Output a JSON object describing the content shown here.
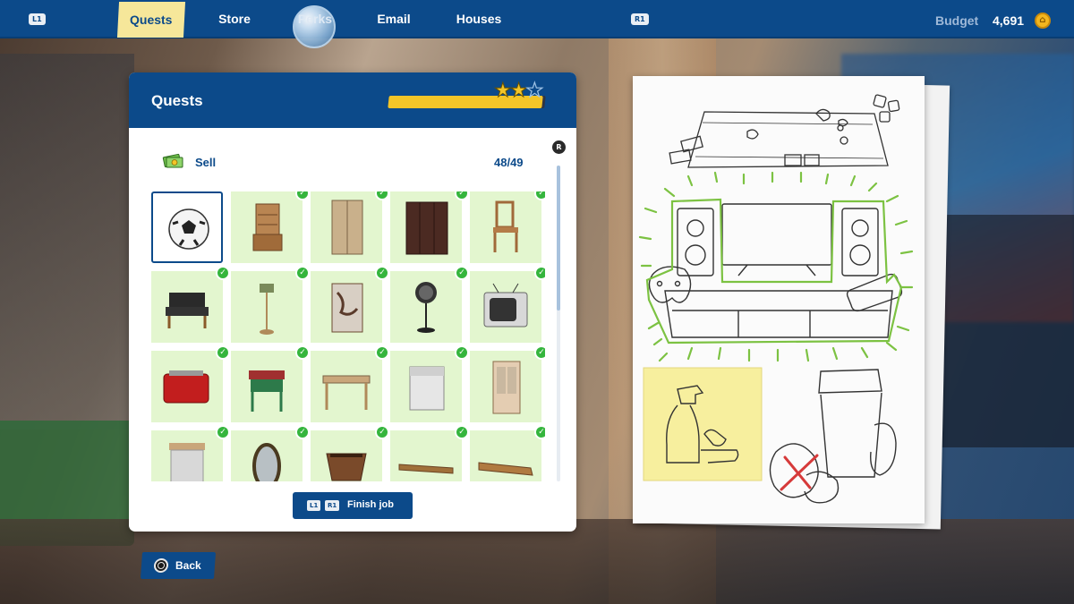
{
  "topbar": {
    "left_hint": "L1",
    "right_hint": "R1",
    "tabs": [
      {
        "label": "Quests",
        "active": true
      },
      {
        "label": "Store",
        "active": false
      },
      {
        "label": "Perks",
        "active": false
      },
      {
        "label": "Email",
        "active": false
      },
      {
        "label": "Houses",
        "active": false
      }
    ],
    "budget_label": "Budget",
    "budget_value": "4,691",
    "coin_icon": "coin-icon"
  },
  "quests_panel": {
    "title": "Quests",
    "progress_fraction": 0.98,
    "stars_earned": 2,
    "stars_total": 3,
    "scroll_hint": "R",
    "section": {
      "label": "Sell",
      "count": "48/49",
      "icon": "money-icon"
    },
    "items": [
      {
        "name": "soccer-ball",
        "done": false,
        "selected": true
      },
      {
        "name": "wooden-cabinet-shelf",
        "done": true
      },
      {
        "name": "wooden-wardrobe",
        "done": true
      },
      {
        "name": "dark-wardrobe",
        "done": true
      },
      {
        "name": "wooden-chair",
        "done": true
      },
      {
        "name": "black-armchair",
        "done": true
      },
      {
        "name": "floor-lamp",
        "done": true
      },
      {
        "name": "folding-screen",
        "done": true
      },
      {
        "name": "standing-fan",
        "done": true
      },
      {
        "name": "retro-tv",
        "done": true
      },
      {
        "name": "red-toaster",
        "done": true
      },
      {
        "name": "green-side-table",
        "done": true
      },
      {
        "name": "wooden-table",
        "done": true
      },
      {
        "name": "washing-machine",
        "done": true
      },
      {
        "name": "glass-cabinet",
        "done": true
      },
      {
        "name": "kitchen-cabinet",
        "done": true
      },
      {
        "name": "oval-mirror",
        "done": true
      },
      {
        "name": "plant-pot",
        "done": true
      },
      {
        "name": "wooden-plank",
        "done": true
      },
      {
        "name": "broken-plank",
        "done": true
      }
    ],
    "finish_button": {
      "hint_left": "L1",
      "hint_right": "R1",
      "label": "Finish job"
    },
    "scroll_fraction": 0.46
  },
  "back_button": {
    "label": "Back",
    "icon": "circle-button-icon"
  },
  "notepad": {
    "sketches": [
      "board-game-sketch",
      "tv-console-sketch",
      "cleaning-supplies-note",
      "trash-bin-sketch"
    ],
    "highlight_color": "#7cc242",
    "sticky_color": "#f7ef9e",
    "cross_color": "#d63a3a"
  },
  "colors": {
    "primary": "#0c4a8a",
    "accent": "#f3c528",
    "done_bg": "#e3f6cf",
    "check": "#35b53d"
  }
}
